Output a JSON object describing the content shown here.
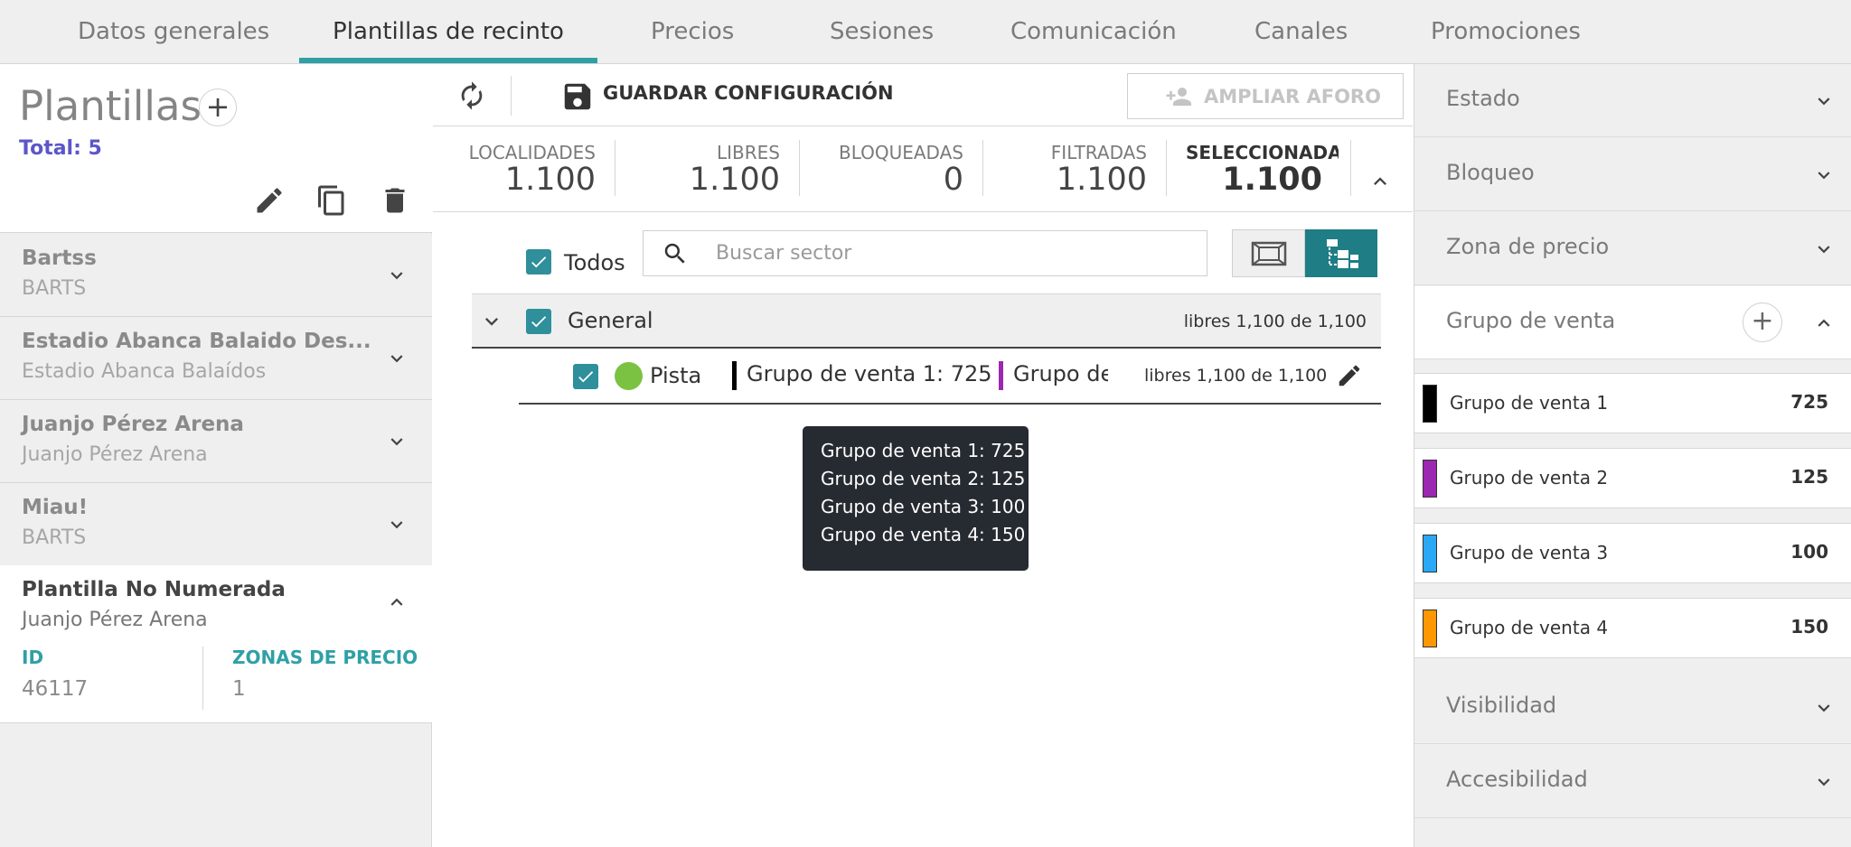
{
  "tabs": [
    {
      "label": "Datos generales"
    },
    {
      "label": "Plantillas de recinto"
    },
    {
      "label": "Precios"
    },
    {
      "label": "Sesiones"
    },
    {
      "label": "Comunicación"
    },
    {
      "label": "Canales"
    },
    {
      "label": "Promociones"
    }
  ],
  "active_tab": "Plantillas de recinto",
  "left": {
    "title": "Plantillas",
    "add_icon": "+",
    "total": "Total: 5",
    "templates": [
      {
        "name": "Bartss",
        "venue": "BARTS"
      },
      {
        "name": "Estadio Abanca Balaido Des...",
        "venue": "Estadio Abanca Balaídos"
      },
      {
        "name": "Juanjo Pérez Arena",
        "venue": "Juanjo Pérez Arena"
      },
      {
        "name": "Miau!",
        "venue": "BARTS"
      },
      {
        "name": "Plantilla No Numerada",
        "venue": "Juanjo Pérez Arena"
      }
    ],
    "selected": {
      "id_label": "ID",
      "id_value": "46117",
      "zones_label": "ZONAS DE PRECIO",
      "zones_value": "1"
    }
  },
  "toolbar": {
    "save_label": "GUARDAR CONFIGURACIÓN",
    "ampliar_label": "AMPLIAR AFORO"
  },
  "stats": [
    {
      "label": "LOCALIDADES",
      "value": "1.100"
    },
    {
      "label": "LIBRES",
      "value": "1.100"
    },
    {
      "label": "BLOQUEADAS",
      "value": "0"
    },
    {
      "label": "FILTRADAS",
      "value": "1.100"
    },
    {
      "label": "SELECCIONADAS",
      "value": "1.100"
    }
  ],
  "filter": {
    "all_label": "Todos",
    "search_placeholder": "Buscar sector"
  },
  "sectors": {
    "general": {
      "name": "General",
      "free": "libres 1,100 de 1,100"
    },
    "pista": {
      "name": "Pista",
      "group1": "Grupo de venta 1: 725",
      "group2": "Grupo de ve",
      "free": "libres 1,100 de 1,100"
    }
  },
  "tooltip": [
    "Grupo de venta 1: 725",
    "Grupo de venta 2: 125",
    "Grupo de venta 3: 100",
    "Grupo de venta 4: 150"
  ],
  "right": {
    "sections": {
      "estado": "Estado",
      "bloqueo": "Bloqueo",
      "zona": "Zona de precio",
      "grupo": "Grupo de venta",
      "visibilidad": "Visibilidad",
      "accesibilidad": "Accesibilidad"
    },
    "sale_groups": [
      {
        "name": "Grupo de venta 1",
        "value": "725",
        "color": "#000000"
      },
      {
        "name": "Grupo de venta 2",
        "value": "125",
        "color": "#9c27b0"
      },
      {
        "name": "Grupo de venta 3",
        "value": "100",
        "color": "#29a8f5"
      },
      {
        "name": "Grupo de venta 4",
        "value": "150",
        "color": "#ff9800"
      }
    ]
  },
  "colors": {
    "accent": "#2fa0a6",
    "checkbox": "#2f8f9b",
    "pista_dot": "#7cc242",
    "total_text": "#5b57c9"
  },
  "icons": [
    "refresh-icon",
    "save-icon",
    "add-person-icon",
    "edit-icon",
    "copy-icon",
    "delete-icon",
    "search-icon",
    "chevron-down-icon",
    "chevron-up-icon",
    "map-view-icon",
    "tree-view-icon"
  ]
}
